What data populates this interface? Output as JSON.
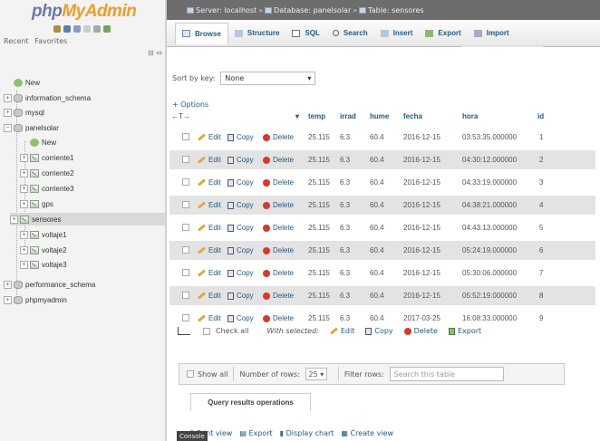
{
  "nav": {
    "logo_php": "php",
    "logo_my": "MyAdmin",
    "recent": "Recent",
    "favorites": "Favorites",
    "tree": [
      {
        "label": "New",
        "icon": "new-icon",
        "level": 0
      },
      {
        "label": "information_schema",
        "icon": "database-icon",
        "level": 0
      },
      {
        "label": "mysql",
        "icon": "database-icon",
        "level": 0
      },
      {
        "label": "panelsolar",
        "icon": "database-icon",
        "level": 0
      },
      {
        "label": "New",
        "icon": "new-icon",
        "level": 1
      },
      {
        "label": "corriente1",
        "icon": "table-icon",
        "level": 1
      },
      {
        "label": "corriente2",
        "icon": "table-icon",
        "level": 1
      },
      {
        "label": "corriente3",
        "icon": "table-icon",
        "level": 1
      },
      {
        "label": "gps",
        "icon": "table-icon",
        "level": 1
      },
      {
        "label": "sensores",
        "icon": "table-icon",
        "level": 1,
        "active": true
      },
      {
        "label": "voltaje1",
        "icon": "table-icon",
        "level": 1
      },
      {
        "label": "voltaje2",
        "icon": "table-icon",
        "level": 1
      },
      {
        "label": "voltaje3",
        "icon": "table-icon",
        "level": 1
      },
      {
        "label": "performance_schema",
        "icon": "database-icon",
        "level": 0
      },
      {
        "label": "phpmyadmin",
        "icon": "database-icon",
        "level": 0
      }
    ]
  },
  "breadcrumb": {
    "server": "Server: localhost",
    "database": "Database: panelsolar",
    "table": "Table: sensores"
  },
  "tabs": [
    {
      "label": "Browse",
      "active": true
    },
    {
      "label": "Structure"
    },
    {
      "label": "SQL"
    },
    {
      "label": "Search"
    },
    {
      "label": "Insert"
    },
    {
      "label": "Export"
    },
    {
      "label": "Import"
    }
  ],
  "sort": {
    "label": "Sort by key:",
    "value": "None"
  },
  "options_link": "+ Options",
  "table": {
    "columns": [
      "temp",
      "irrad",
      "hume",
      "fecha",
      "hora",
      "id"
    ],
    "actions": {
      "edit": "Edit",
      "copy": "Copy",
      "delete": "Delete"
    },
    "rows": [
      [
        "25.115",
        "6.3",
        "60.4",
        "2016-12-15",
        "03:53:35.000000",
        "1"
      ],
      [
        "25.115",
        "6.3",
        "60.4",
        "2016-12-15",
        "04:30:12.000000",
        "2"
      ],
      [
        "25.115",
        "6.3",
        "60.4",
        "2016-12-15",
        "04:33:19.000000",
        "3"
      ],
      [
        "25.115",
        "6.3",
        "60.4",
        "2016-12-15",
        "04:38:21.000000",
        "4"
      ],
      [
        "25.115",
        "6.3",
        "60.4",
        "2016-12-15",
        "04:43:13.000000",
        "5"
      ],
      [
        "25.115",
        "6.3",
        "60.4",
        "2016-12-15",
        "05:24:19.000000",
        "6"
      ],
      [
        "25.115",
        "6.3",
        "60.4",
        "2016-12-15",
        "05:30:06.000000",
        "7"
      ],
      [
        "25.115",
        "6.3",
        "60.4",
        "2016-12-15",
        "05:52:19.000000",
        "8"
      ],
      [
        "25.115",
        "6.3",
        "60.4",
        "2017-03-25",
        "16:08:33.000000",
        "9"
      ]
    ]
  },
  "bulk": {
    "check_all": "Check all",
    "with_selected": "With selected:",
    "edit": "Edit",
    "copy": "Copy",
    "delete": "Delete",
    "export": "Export"
  },
  "navbar": {
    "show_all": "Show all",
    "rows_label": "Number of rows:",
    "rows_value": "25",
    "filter_label": "Filter rows:",
    "filter_placeholder": "Search this table"
  },
  "query_ops": {
    "title": "Query results operations",
    "print": "Print view",
    "export": "Export",
    "chart": "Display chart",
    "view": "Create view"
  },
  "console": "Console"
}
